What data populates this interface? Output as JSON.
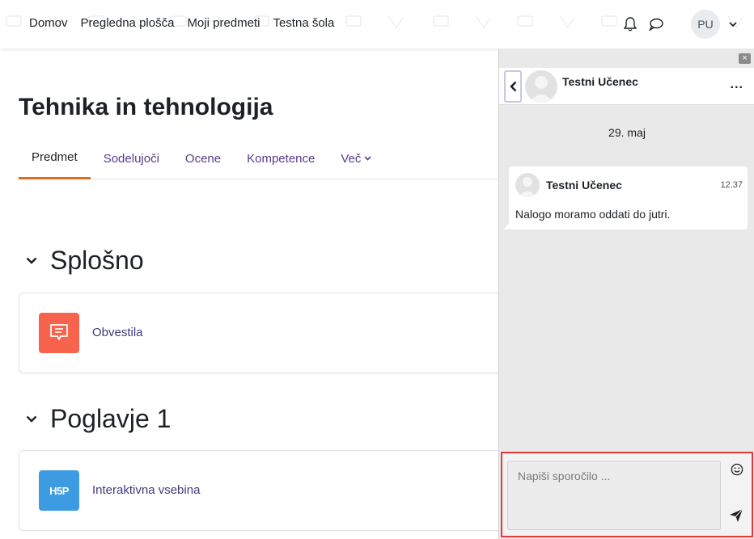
{
  "navbar": {
    "links": [
      "Domov",
      "Pregledna plošča",
      "Moji predmeti",
      "Testna šola"
    ],
    "user_initials": "PU",
    "icons": [
      "bell-icon",
      "chat-bubble-icon",
      "chevron-down-icon"
    ]
  },
  "course": {
    "title": "Tehnika in tehnologija",
    "tabs": [
      "Predmet",
      "Sodelujoči",
      "Ocene",
      "Kompetence",
      "Več"
    ],
    "active_tab": "Predmet"
  },
  "sections": [
    {
      "title": "Splošno",
      "activity": {
        "label": "Obvestila",
        "icon": "forum-icon",
        "color": "#f7634d"
      }
    },
    {
      "title": "Poglavje 1",
      "activity": {
        "label": "Interaktivna vsebina",
        "icon": "h5p-icon",
        "icon_text": "H5P",
        "color": "#3d9be2"
      }
    }
  ],
  "drawer": {
    "close_symbol": "×",
    "conversation": {
      "contact_name": "Testni Učenec",
      "more_symbol": "..."
    },
    "date_separator": "29. maj",
    "messages": [
      {
        "sender": "Testni Učenec",
        "time": "12.37",
        "text": "Nalogo moramo oddati do jutri."
      }
    ],
    "composer": {
      "placeholder": "Napiši sporočilo ..."
    }
  },
  "colors": {
    "accent_tab": "#d96e1c",
    "link": "#5a3a8a",
    "highlight_border": "#e53935"
  }
}
